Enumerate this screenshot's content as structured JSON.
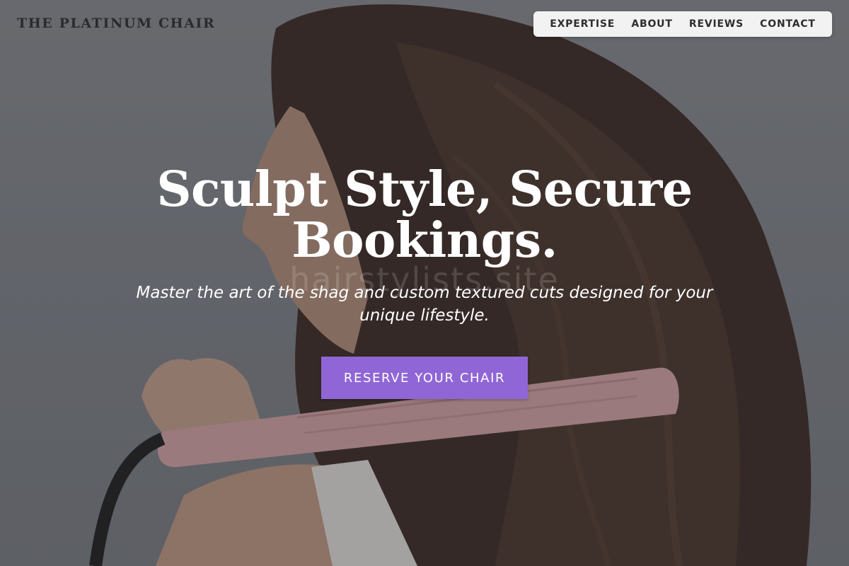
{
  "header": {
    "logo_text": "THE PLATINUM CHAIR",
    "nav": [
      {
        "label": "EXPERTISE"
      },
      {
        "label": "ABOUT"
      },
      {
        "label": "REVIEWS"
      },
      {
        "label": "CONTACT"
      }
    ]
  },
  "hero": {
    "title": "Sculpt Style, Secure Bookings.",
    "subtitle": "Master the art of the shag and custom textured cuts designed for your unique lifestyle.",
    "cta_label": "RESERVE YOUR CHAIR",
    "watermark": "hairstylists.site",
    "image_subject": "woman with long wavy brown hair holding a pink hair straightener"
  },
  "colors": {
    "cta": "#9066d6",
    "nav_background": "#f2f2f2",
    "logo_text": "#2b2b2e",
    "hero_text": "#ffffff"
  }
}
